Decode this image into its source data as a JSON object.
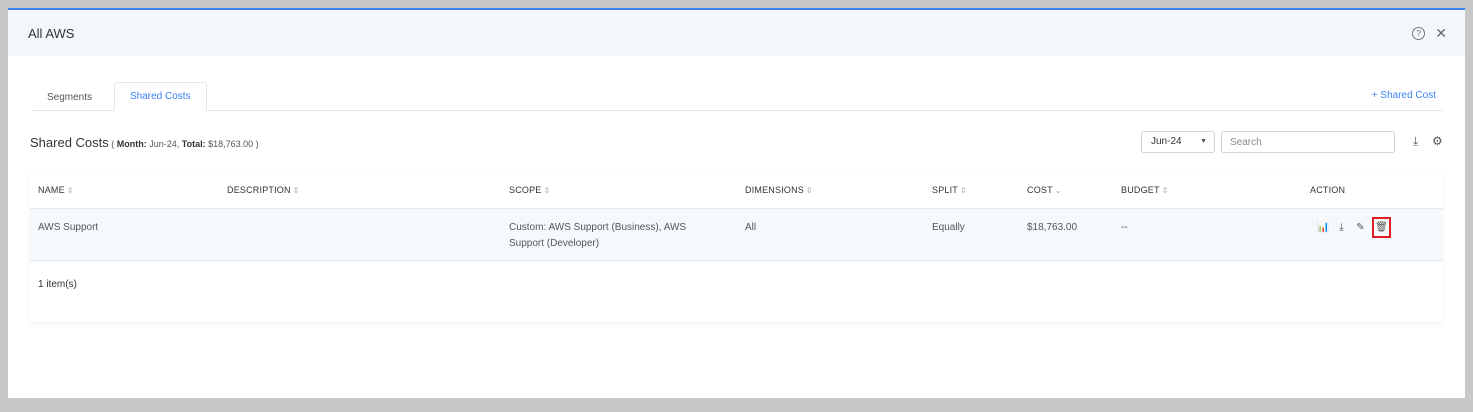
{
  "window": {
    "title": "All AWS"
  },
  "tabs": [
    {
      "label": "Segments"
    },
    {
      "label": "Shared Costs"
    }
  ],
  "add_shared_cost": "+ Shared Cost",
  "heading": {
    "title": "Shared Costs",
    "open_paren": " ( ",
    "month_label": "Month:",
    "month_value": " Jun-24, ",
    "total_label": "Total:",
    "total_value": " $18,763.00 )"
  },
  "month_select": {
    "value": "Jun-24"
  },
  "search": {
    "placeholder": "Search"
  },
  "table": {
    "columns": [
      "NAME",
      "DESCRIPTION",
      "SCOPE",
      "DIMENSIONS",
      "SPLIT",
      "COST",
      "BUDGET",
      "ACTION"
    ],
    "rows": [
      {
        "name": "AWS Support",
        "description": "",
        "scope": "Custom: AWS Support (Business), AWS Support (Developer)",
        "dimensions": "All",
        "split": "Equally",
        "cost": "$18,763.00",
        "budget": "--"
      }
    ]
  },
  "footer": {
    "count": "1 item(s)"
  },
  "icons": [
    "help-icon",
    "close-icon",
    "download-icon",
    "gear-icon",
    "chart-icon",
    "edit-icon",
    "delete-icon"
  ],
  "colors": {
    "accent": "#3b82f6",
    "highlight": "#e11d24"
  }
}
